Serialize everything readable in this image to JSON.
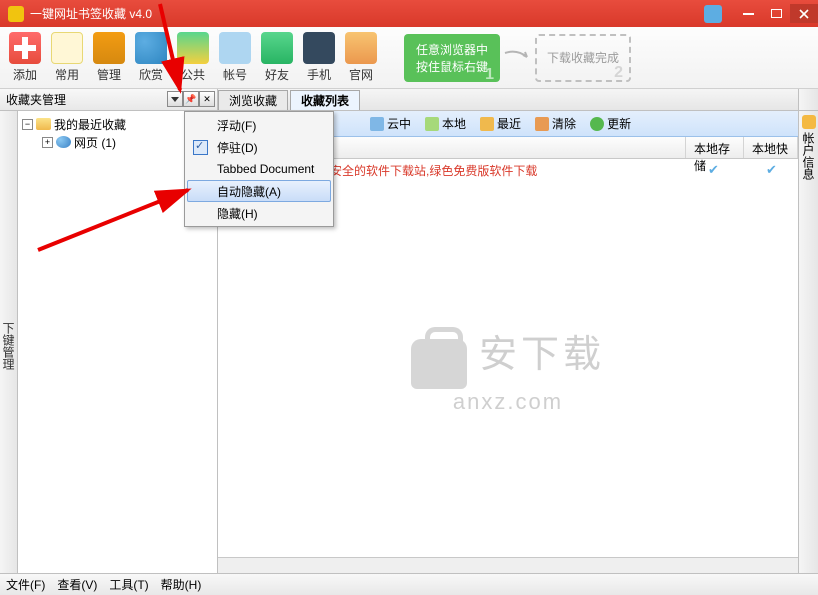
{
  "window": {
    "title": "一键网址书签收藏 v4.0"
  },
  "toolbar": {
    "items": [
      {
        "label": "添加"
      },
      {
        "label": "常用"
      },
      {
        "label": "管理"
      },
      {
        "label": "欣赏"
      },
      {
        "label": "公共"
      },
      {
        "label": "帐号"
      },
      {
        "label": "好友"
      },
      {
        "label": "手机"
      },
      {
        "label": "官网"
      }
    ],
    "card1_line1": "任意浏览器中",
    "card1_line2": "按住鼠标右键",
    "card1_num": "1",
    "card2_line1": "下载收藏完成",
    "card2_num": "2"
  },
  "side_panel": {
    "title": "收藏夹管理"
  },
  "tabs": {
    "browse": "浏览收藏",
    "list": "收藏列表"
  },
  "tree": {
    "root": "我的最近收藏",
    "child": "网页 (1)"
  },
  "context_menu": {
    "items": [
      {
        "label": "浮动(F)",
        "checked": false
      },
      {
        "label": "停驻(D)",
        "checked": true
      },
      {
        "label": "Tabbed Document",
        "checked": false
      },
      {
        "label": "自动隐藏(A)",
        "checked": false,
        "highlighted": true
      },
      {
        "label": "隐藏(H)",
        "checked": false
      }
    ]
  },
  "filterbar": {
    "items": [
      {
        "label": "云中",
        "icon": "#7fb7e6"
      },
      {
        "label": "本地",
        "icon": "#a6d97a"
      },
      {
        "label": "最近",
        "icon": "#f0b94d"
      },
      {
        "label": "清除",
        "icon": "#e89a53"
      },
      {
        "label": "更新",
        "icon": "#55b84e"
      }
    ]
  },
  "columns": {
    "col1": "本地存储",
    "col2": "本地快"
  },
  "row_text": "-安全的软件下载站,绿色免费版软件下载",
  "left_tiny_label": "下键管理",
  "right_tiny_label": "帐户信息",
  "watermark": {
    "line1": "安下载",
    "line2": "anxz.com"
  },
  "menubar": {
    "items": [
      "文件(F)",
      "查看(V)",
      "工具(T)",
      "帮助(H)"
    ]
  }
}
